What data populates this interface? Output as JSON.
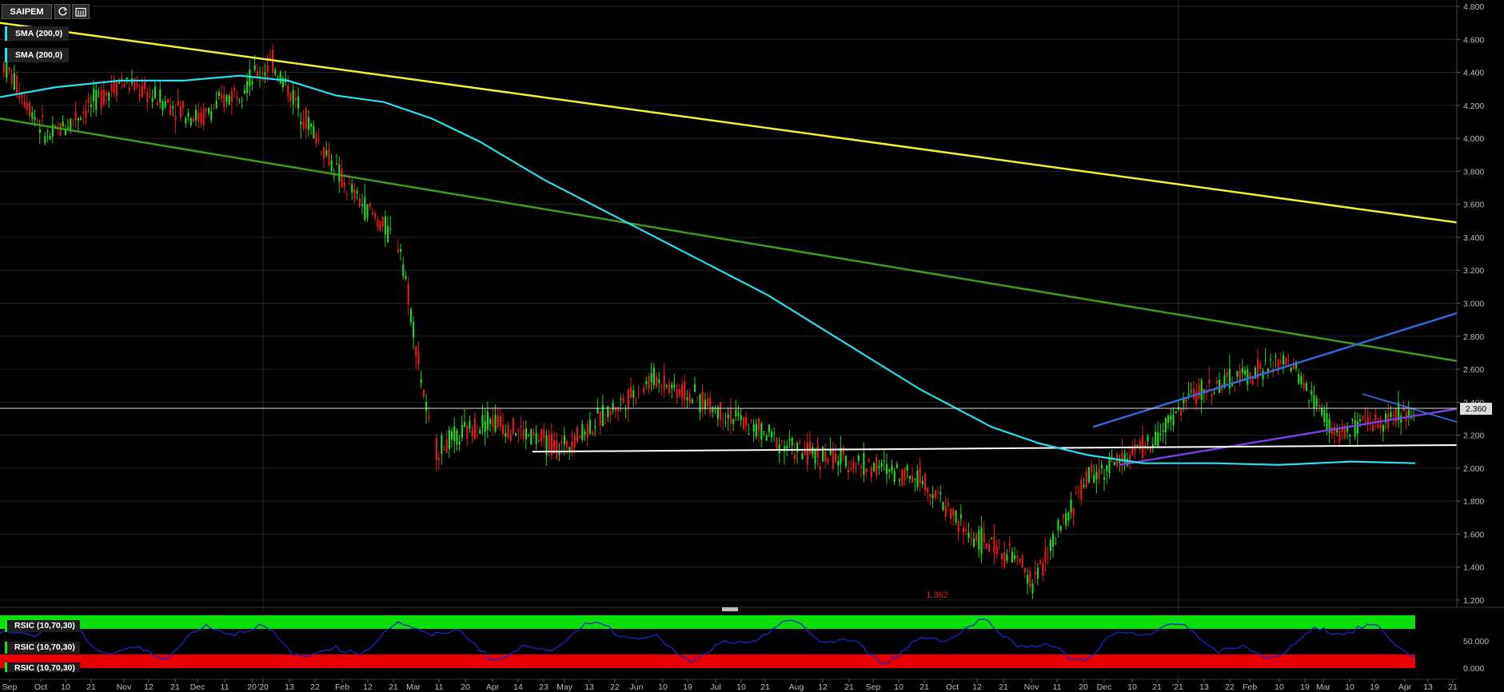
{
  "toolbar": {
    "symbol": "SAIPEM",
    "refresh_icon": "refresh-icon",
    "calendar_icon": "calendar-icon"
  },
  "indicators": {
    "sma_1": "SMA (200,0)",
    "sma_2": "SMA (200,0)",
    "rsi_1": "RSIC (10,70,30)",
    "rsi_2": "RSIC (10,70,30)",
    "rsi_3": "RSIC (10,70,30)"
  },
  "colors": {
    "up": "#22d322",
    "down": "#e01a1a",
    "sma": "#29e0f0",
    "trend_yellow": "#f2ef3a",
    "trend_green": "#3f9a1f",
    "channel_blue": "#2f6ad8",
    "purple": "#7b3fe0",
    "support_white": "#ffffff",
    "rsi_line": "#1826c8",
    "rsi_overbought": "#0adf0a",
    "rsi_oversold": "#e80000"
  },
  "chart_data": {
    "type": "candlestick",
    "symbol": "SAIPEM",
    "y_axis_ticks": [
      "4.800",
      "4.600",
      "4.400",
      "4.200",
      "4.000",
      "3.800",
      "3.600",
      "3.400",
      "3.200",
      "3.000",
      "2.800",
      "2.600",
      "2.400",
      "2.200",
      "2.000",
      "1.800",
      "1.600",
      "1.400",
      "1.200"
    ],
    "ylim": [
      1.2,
      4.8
    ],
    "current_price_label": "2.360",
    "current_price": 2.36,
    "low_annotation": "1.362",
    "low_value": 1.362,
    "x_axis_labels": [
      "Sep",
      "Oct",
      "10",
      "21",
      "Nov",
      "12",
      "21",
      "Dec",
      "11",
      "20",
      "'20",
      "13",
      "22",
      "Feb",
      "12",
      "21",
      "Mar",
      "11",
      "20",
      "Apr",
      "14",
      "23",
      "May",
      "13",
      "22",
      "Jun",
      "10",
      "19",
      "Jul",
      "10",
      "21",
      "Aug",
      "12",
      "21",
      "Sep",
      "10",
      "21",
      "Oct",
      "12",
      "21",
      "Nov",
      "11",
      "20",
      "Dec",
      "10",
      "21",
      "'21",
      "13",
      "22",
      "Feb",
      "10",
      "19",
      "Mar",
      "10",
      "19",
      "Apr",
      "13",
      "21"
    ],
    "x_range": [
      "Sep 2019",
      "Apr 2021"
    ],
    "key_levels": {
      "support": 2.1,
      "sma_200_end": 2.03
    },
    "price_path": [
      {
        "date": "2019-09",
        "close": 4.48
      },
      {
        "date": "2019-10",
        "close": 4.0
      },
      {
        "date": "2019-11",
        "close": 4.35
      },
      {
        "date": "2019-12",
        "close": 4.12
      },
      {
        "date": "2020-01",
        "close": 4.46
      },
      {
        "date": "2020-02",
        "close": 3.72
      },
      {
        "date": "2020-03-10",
        "close": 3.35
      },
      {
        "date": "2020-03-16",
        "close": 2.1
      },
      {
        "date": "2020-04",
        "close": 2.3
      },
      {
        "date": "2020-05",
        "close": 2.12
      },
      {
        "date": "2020-06",
        "close": 2.55
      },
      {
        "date": "2020-07",
        "close": 2.1
      },
      {
        "date": "2020-08",
        "close": 1.95
      },
      {
        "date": "2020-09",
        "close": 1.6
      },
      {
        "date": "2020-10",
        "close": 1.45
      },
      {
        "date": "2020-10-30",
        "close": 1.3
      },
      {
        "date": "2020-11",
        "close": 1.95
      },
      {
        "date": "2020-12",
        "close": 2.15
      },
      {
        "date": "2021-01",
        "close": 2.45
      },
      {
        "date": "2021-02",
        "close": 2.65
      },
      {
        "date": "2021-03",
        "close": 2.2
      },
      {
        "date": "2021-04",
        "close": 2.36
      }
    ],
    "rsi": {
      "params": "10,70,30",
      "overbought": 70,
      "oversold": 30,
      "axis_labels": [
        "50.000",
        "0.000"
      ]
    }
  }
}
